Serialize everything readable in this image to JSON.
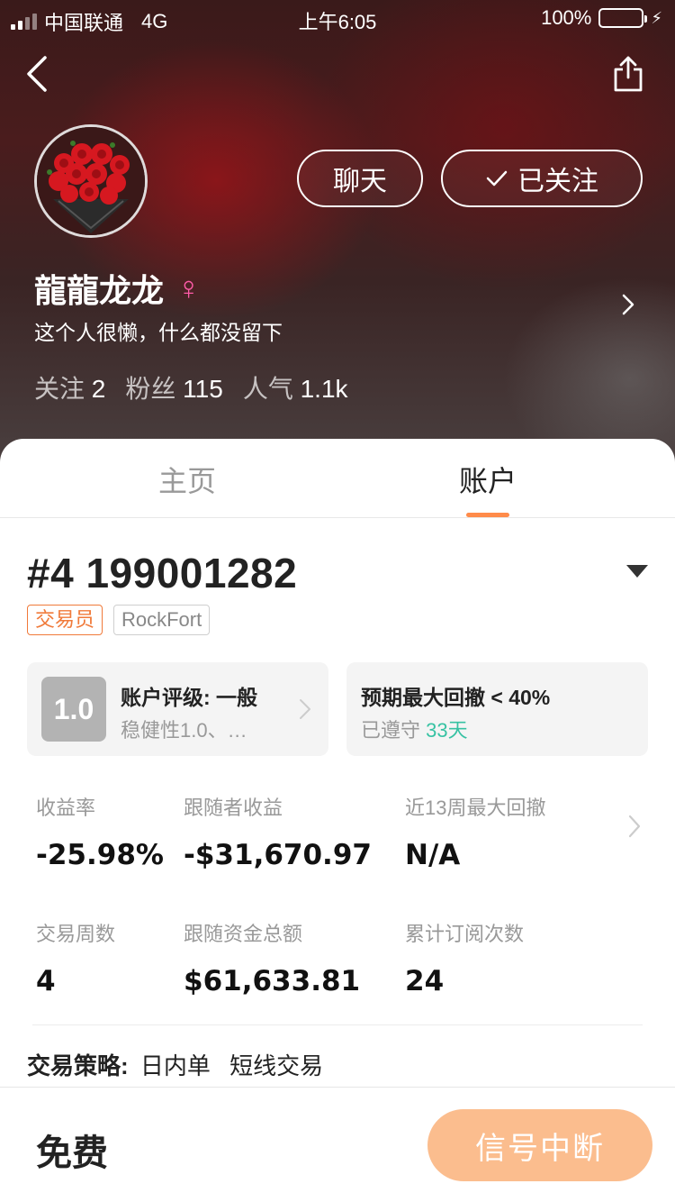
{
  "status_bar": {
    "carrier": "中国联通",
    "network": "4G",
    "time": "上午6:05",
    "battery": "100%"
  },
  "header": {
    "chat_label": "聊天",
    "follow_label": "已关注"
  },
  "profile": {
    "name": "龍龍龙龙",
    "gender_symbol": "♀",
    "bio": "这个人很懒，什么都没留下",
    "stats": [
      {
        "label": "关注",
        "value": "2"
      },
      {
        "label": "粉丝",
        "value": "115"
      },
      {
        "label": "人气",
        "value": "1.1k"
      }
    ]
  },
  "tabs": [
    {
      "label": "主页"
    },
    {
      "label": "账户"
    }
  ],
  "account": {
    "number": "#4 199001282",
    "tags": [
      "交易员",
      "RockFort"
    ],
    "rating": {
      "score": "1.0",
      "title": "账户评级: 一般",
      "subtitle": "稳健性1.0、…"
    },
    "drawdown": {
      "title": "预期最大回撤 < 40%",
      "subtitle_prefix": "已遵守",
      "days": "33天"
    },
    "metrics": [
      {
        "label": "收益率",
        "value": "-25.98%"
      },
      {
        "label": "跟随者收益",
        "value": "-$31,670.97"
      },
      {
        "label": "近13周最大回撤",
        "value": "N/A"
      },
      {
        "label": "交易周数",
        "value": "4"
      },
      {
        "label": "跟随资金总额",
        "value": "$61,633.81"
      },
      {
        "label": "累计订阅次数",
        "value": "24"
      }
    ],
    "strategy_label": "交易策略:",
    "strategy_values": [
      "日内单",
      "短线交易"
    ]
  },
  "bottom_bar": {
    "price": "免费",
    "signal_label": "信号中断"
  }
}
